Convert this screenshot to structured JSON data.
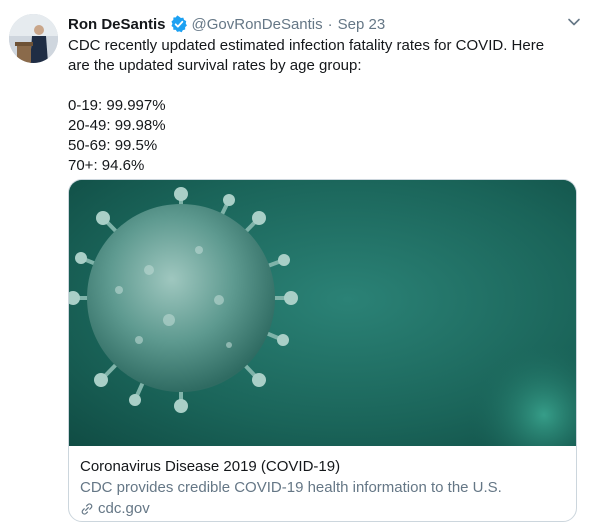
{
  "author": {
    "name": "Ron DeSantis",
    "handle": "@GovRonDeSantis",
    "separator": "·",
    "date": "Sep 23"
  },
  "icons": {
    "verified": "verified-badge-icon",
    "more": "chevron-down-icon",
    "link": "link-icon"
  },
  "colors": {
    "verified_blue": "#1da1f2",
    "secondary_text": "#657786"
  },
  "tweet": {
    "line1": "CDC recently updated estimated infection fatality rates for COVID. Here",
    "line2": "are the updated survival rates by age group:",
    "rates": [
      "0-19: 99.997%",
      "20-49: 99.98%",
      "50-69: 99.5%",
      "70+: 94.6%"
    ]
  },
  "card": {
    "title": "Coronavirus Disease 2019 (COVID-19)",
    "description": "CDC provides credible COVID-19 health information to the U.S.",
    "domain": "cdc.gov"
  }
}
